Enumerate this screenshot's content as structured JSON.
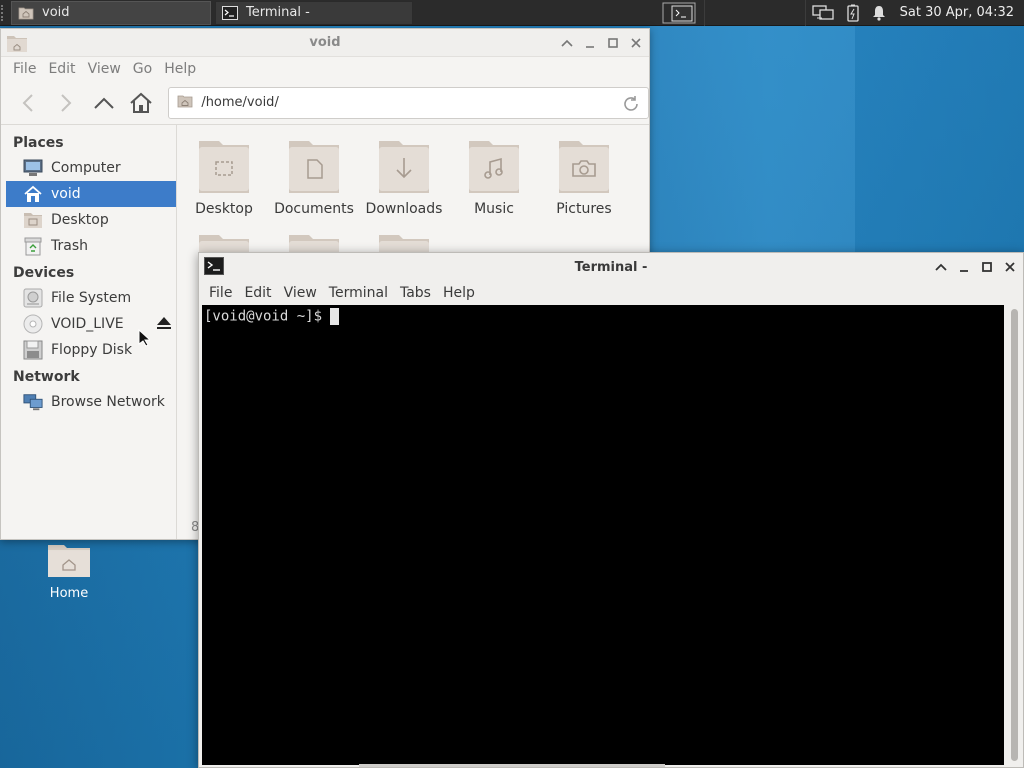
{
  "panel": {
    "tasks": [
      {
        "label": "void",
        "icon": "folder-home-icon"
      },
      {
        "label": "Terminal -",
        "icon": "terminal-icon"
      }
    ],
    "tray": [
      "workspace-switcher-icon",
      "network-icon",
      "battery-icon",
      "notification-bell-icon"
    ],
    "clock": "Sat 30 Apr, 04:32"
  },
  "desktop": {
    "icons": [
      {
        "label": "Home"
      }
    ]
  },
  "file_manager": {
    "title": "void",
    "menu": [
      "File",
      "Edit",
      "View",
      "Go",
      "Help"
    ],
    "location": "/home/void/",
    "sidebar": {
      "places_header": "Places",
      "places": [
        {
          "label": "Computer",
          "icon": "computer-icon"
        },
        {
          "label": "void",
          "icon": "home-icon",
          "selected": true
        },
        {
          "label": "Desktop",
          "icon": "desktop-folder-icon"
        },
        {
          "label": "Trash",
          "icon": "trash-icon"
        }
      ],
      "devices_header": "Devices",
      "devices": [
        {
          "label": "File System",
          "icon": "drive-icon"
        },
        {
          "label": "VOID_LIVE",
          "icon": "optical-disc-icon"
        },
        {
          "label": "Floppy Disk",
          "icon": "floppy-icon"
        }
      ],
      "network_header": "Network",
      "network": [
        {
          "label": "Browse Network",
          "icon": "network-icon"
        }
      ]
    },
    "folders": [
      {
        "label": "Desktop",
        "glyph": "desktop-glyph-icon"
      },
      {
        "label": "Documents",
        "glyph": "document-glyph-icon"
      },
      {
        "label": "Downloads",
        "glyph": "download-glyph-icon"
      },
      {
        "label": "Music",
        "glyph": "music-glyph-icon"
      },
      {
        "label": "Pictures",
        "glyph": "camera-glyph-icon"
      }
    ],
    "status": "8"
  },
  "terminal": {
    "title": "Terminal -",
    "menu": [
      "File",
      "Edit",
      "View",
      "Terminal",
      "Tabs",
      "Help"
    ],
    "prompt": "[void@void ~]$"
  },
  "colors": {
    "selection": "#3d7cc9",
    "desktop": "#1f7db8",
    "panel": "#2b2b2b",
    "folder": "#d8cfc6"
  }
}
